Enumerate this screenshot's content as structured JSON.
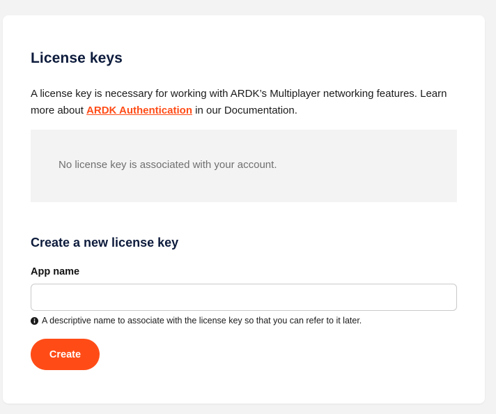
{
  "license_keys": {
    "title": "License keys",
    "description_prefix": "A license key is necessary for working with ARDK’s Multiplayer networking features. Learn more about ",
    "link_text": "ARDK Authentication",
    "description_suffix": " in our Documentation.",
    "empty_message": "No license key is associated with your account."
  },
  "create": {
    "title": "Create a new license key",
    "app_name_label": "App name",
    "app_name_value": "",
    "app_name_placeholder": "",
    "hint": "A descriptive name to associate with the license key so that you can refer to it later.",
    "hint_icon": "info-icon",
    "button_label": "Create"
  },
  "colors": {
    "accent": "#ff4c17",
    "heading": "#0d1b3c",
    "page_background": "#f3f3f3",
    "card_background": "#ffffff"
  }
}
